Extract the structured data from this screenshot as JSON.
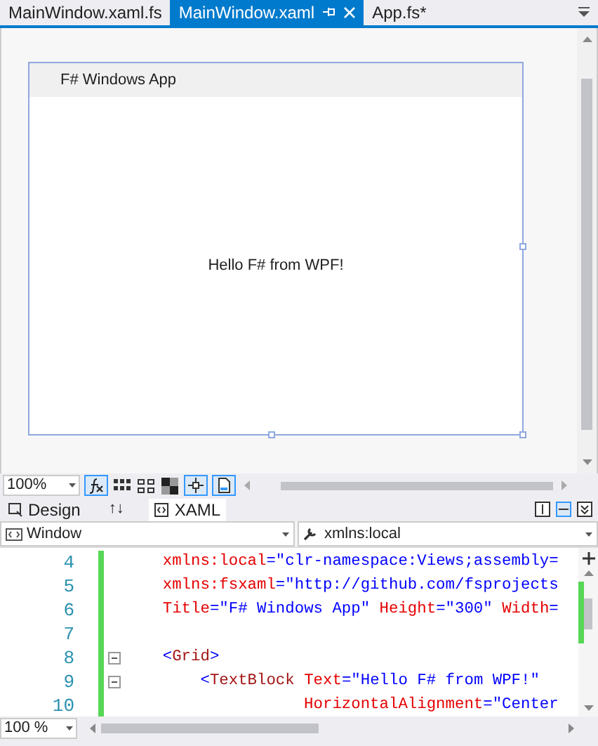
{
  "tabs": [
    {
      "label": "MainWindow.xaml.fs",
      "selected": false
    },
    {
      "label": "MainWindow.xaml",
      "selected": true
    },
    {
      "label": "App.fs*",
      "selected": false
    }
  ],
  "designer": {
    "window_title": "F# Windows App",
    "content_text": "Hello F# from WPF!"
  },
  "design_toolbar": {
    "zoom": "100%"
  },
  "view_tabs": [
    {
      "label": "Design",
      "selected": false
    },
    {
      "label": "XAML",
      "selected": true
    }
  ],
  "swap_label": "↑↓",
  "element_dropdown": "Window",
  "member_dropdown": "xmlns:local",
  "code_lines": [
    {
      "number": "4",
      "collapsible": false,
      "tokens": [
        {
          "kind": "attr",
          "text": "    xmlns:local"
        },
        {
          "kind": "value",
          "text": "=\"clr-namespace:Views;assembly="
        }
      ]
    },
    {
      "number": "5",
      "collapsible": false,
      "tokens": [
        {
          "kind": "attr",
          "text": "    xmlns:fsxaml"
        },
        {
          "kind": "value",
          "text": "=\"http://github.com/fsprojects"
        }
      ]
    },
    {
      "number": "6",
      "collapsible": false,
      "tokens": [
        {
          "kind": "attr",
          "text": "    Title"
        },
        {
          "kind": "value",
          "text": "=\"F# Windows App\""
        },
        {
          "kind": "attr",
          "text": " Height"
        },
        {
          "kind": "value",
          "text": "=\"300\""
        },
        {
          "kind": "attr",
          "text": " Width"
        },
        {
          "kind": "value",
          "text": "="
        }
      ]
    },
    {
      "number": "7",
      "collapsible": false
    },
    {
      "number": "8",
      "collapsible": true,
      "tokens": [
        {
          "kind": "value",
          "text": "    <"
        },
        {
          "kind": "tag",
          "text": "Grid"
        },
        {
          "kind": "value",
          "text": ">"
        }
      ]
    },
    {
      "number": "9",
      "collapsible": true,
      "tokens": [
        {
          "kind": "value",
          "text": "        <"
        },
        {
          "kind": "tag",
          "text": "TextBlock"
        },
        {
          "kind": "attr",
          "text": " Text"
        },
        {
          "kind": "value",
          "text": "=\"Hello F# from WPF!\""
        }
      ]
    },
    {
      "number": "10",
      "collapsible": false,
      "tokens": [
        {
          "kind": "attr",
          "text": "                   HorizontalAlignment"
        },
        {
          "kind": "value",
          "text": "=\"Center"
        }
      ]
    }
  ],
  "editor_zoom": "100 %"
}
